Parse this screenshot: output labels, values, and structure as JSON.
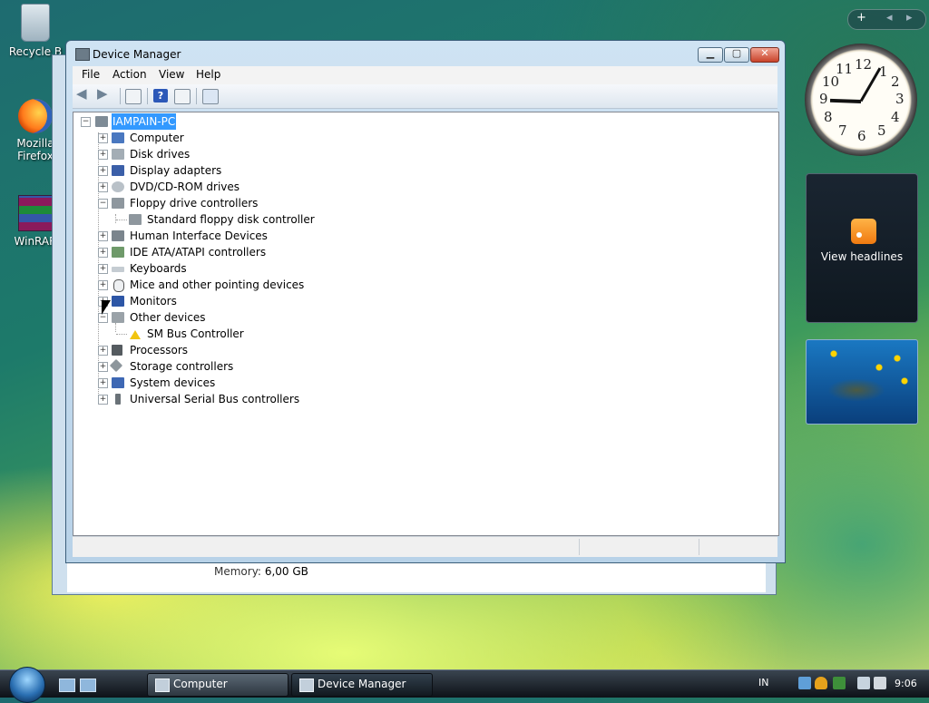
{
  "desktop": {
    "icons": [
      {
        "label": "Recycle B",
        "icon": "recycle-bin-icon"
      },
      {
        "label": "Mozilla Firefox",
        "icon": "firefox-icon"
      },
      {
        "label": "WinRAR",
        "icon": "winrar-icon"
      }
    ]
  },
  "behind_window": {
    "memory_label": "Memory:",
    "memory_value": "6,00 GB"
  },
  "window": {
    "title": "Device Manager",
    "controls": {
      "minimize": "▁",
      "maximize": "▢",
      "close": "✕"
    },
    "menu": [
      "File",
      "Action",
      "View",
      "Help"
    ],
    "toolbar": [
      "back-icon",
      "forward-icon",
      "properties-icon",
      "help-icon",
      "show-hidden-icon",
      "scan-hardware-icon"
    ],
    "tree": {
      "root": "IAMPAIN-PC",
      "categories": [
        {
          "label": "Computer",
          "expanded": false
        },
        {
          "label": "Disk drives",
          "expanded": false
        },
        {
          "label": "Display adapters",
          "expanded": false
        },
        {
          "label": "DVD/CD-ROM drives",
          "expanded": false
        },
        {
          "label": "Floppy drive controllers",
          "expanded": true,
          "children": [
            "Standard floppy disk controller"
          ]
        },
        {
          "label": "Human Interface Devices",
          "expanded": false
        },
        {
          "label": "IDE ATA/ATAPI controllers",
          "expanded": false
        },
        {
          "label": "Keyboards",
          "expanded": false
        },
        {
          "label": "Mice and other pointing devices",
          "expanded": false
        },
        {
          "label": "Monitors",
          "expanded": false
        },
        {
          "label": "Other devices",
          "expanded": true,
          "children": [
            "SM Bus Controller"
          ]
        },
        {
          "label": "Processors",
          "expanded": false
        },
        {
          "label": "Storage controllers",
          "expanded": false
        },
        {
          "label": "System devices",
          "expanded": false
        },
        {
          "label": "Universal Serial Bus controllers",
          "expanded": false
        }
      ]
    }
  },
  "sidebar": {
    "controls": {
      "add": "+",
      "prev": "◂",
      "next": "▸"
    },
    "clock_numbers": [
      "12",
      "1",
      "2",
      "3",
      "4",
      "5",
      "6",
      "7",
      "8",
      "9",
      "10",
      "11"
    ],
    "feed_label": "View headlines"
  },
  "taskbar": {
    "buttons": [
      {
        "label": "Computer",
        "active": false
      },
      {
        "label": "Device Manager",
        "active": true
      }
    ],
    "language": "IN",
    "time": "9:06"
  }
}
